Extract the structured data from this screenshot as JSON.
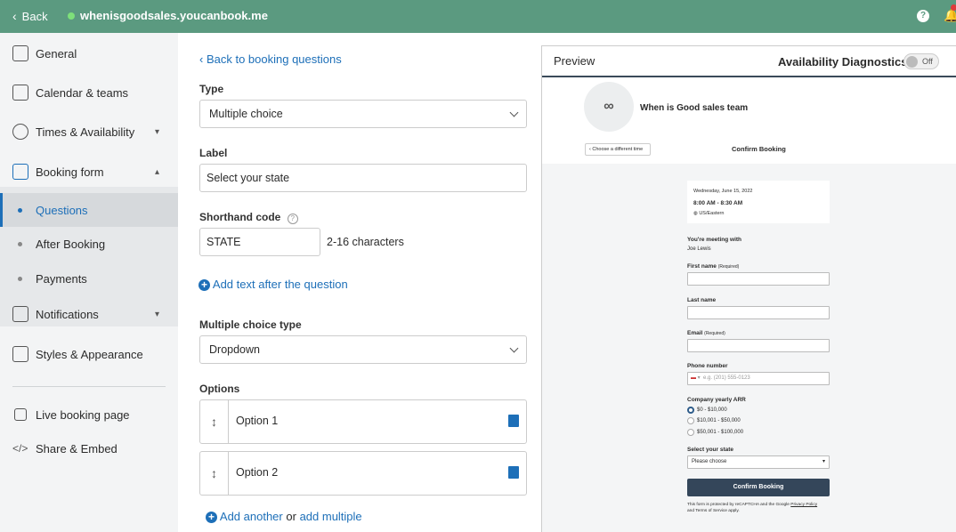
{
  "topbar": {
    "back_label": "Back",
    "site": "whenisgoodsales.youcanbook.me",
    "help": "?",
    "colors": {
      "bar": "#5b9a80",
      "accent": "#1d6fb8"
    }
  },
  "sidebar": {
    "general": "General",
    "calendar": "Calendar & teams",
    "times": "Times & Availability",
    "booking_form": "Booking form",
    "questions": "Questions",
    "after_booking": "After Booking",
    "payments": "Payments",
    "notifications": "Notifications",
    "styles": "Styles & Appearance",
    "live": "Live booking page",
    "share": "Share & Embed"
  },
  "editor": {
    "back_link": "Back to booking questions",
    "type_label": "Type",
    "type_value": "Multiple choice",
    "label_label": "Label",
    "label_value": "Select your state",
    "shorthand_label": "Shorthand code",
    "shorthand_value": "STATE",
    "shorthand_hint": "2-16 characters",
    "add_text": "Add text after the question",
    "mc_type_label": "Multiple choice type",
    "mc_type_value": "Dropdown",
    "options_label": "Options",
    "options": [
      {
        "text": "Option 1"
      },
      {
        "text": "Option 2"
      }
    ],
    "add_another": "Add another",
    "or": "or",
    "add_multiple": "add multiple"
  },
  "preview": {
    "title": "Preview",
    "diagnostics": "Availability Diagnostics",
    "toggle": "Off",
    "team": "When is Good sales team",
    "choose_time": "Choose a different time",
    "confirm_title": "Confirm Booking",
    "date": "Wednesday, June 15, 2022",
    "time": "8:00 AM - 8:30 AM",
    "tz": "US/Eastern",
    "meeting_with": "You're meeting with",
    "host": "Joe Lewis",
    "first_name": "First name",
    "required": "(Required)",
    "last_name": "Last name",
    "email": "Email",
    "phone": "Phone number",
    "phone_placeholder": "e.g. (201) 555-0123",
    "arr": "Company yearly ARR",
    "arr_options": [
      "$0 - $10,000",
      "$10,001 - $50,000",
      "$50,001 - $100,000"
    ],
    "state_label": "Select your state",
    "state_value": "Please choose",
    "cta": "Confirm Booking",
    "footer1": "This form is protected by reCAPTCHA and the Google",
    "privacy": "Privacy Policy",
    "footer2": "and Terms of Service apply."
  }
}
